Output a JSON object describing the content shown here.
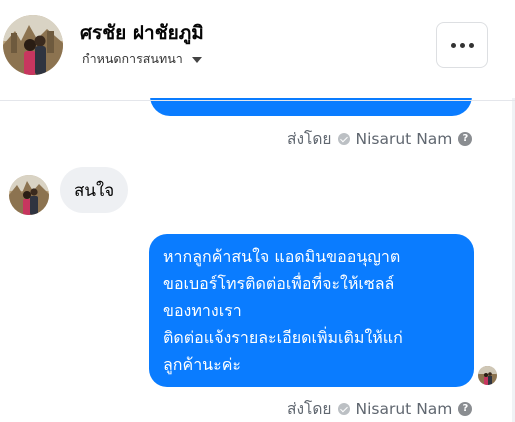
{
  "header": {
    "name": "ศรชัย ฝาชัยภูมิ",
    "subtitle": "กำหนดการสนทนา"
  },
  "messages": {
    "sent_by_prefix": "ส่งโดย",
    "sender_name": "Nisarut Nam",
    "help_symbol": "?",
    "received_text": "สนใจ",
    "sent_lines": [
      "หากลูกค้าสนใจ แอดมินขออนุญาต",
      "ขอเบอร์โทรติดต่อเพื่อที่จะให้เซลล์",
      "ของทางเรา",
      "ติดต่อแจ้งรายละเอียดเพิ่มเติมให้แก่",
      "ลูกค้านะค่ะ"
    ]
  },
  "colors": {
    "bubble_blue": "#0a7cff",
    "received_bg": "#eef0f3"
  },
  "icons": [
    "more-icon",
    "caret-down-icon",
    "check-icon",
    "help-icon"
  ]
}
